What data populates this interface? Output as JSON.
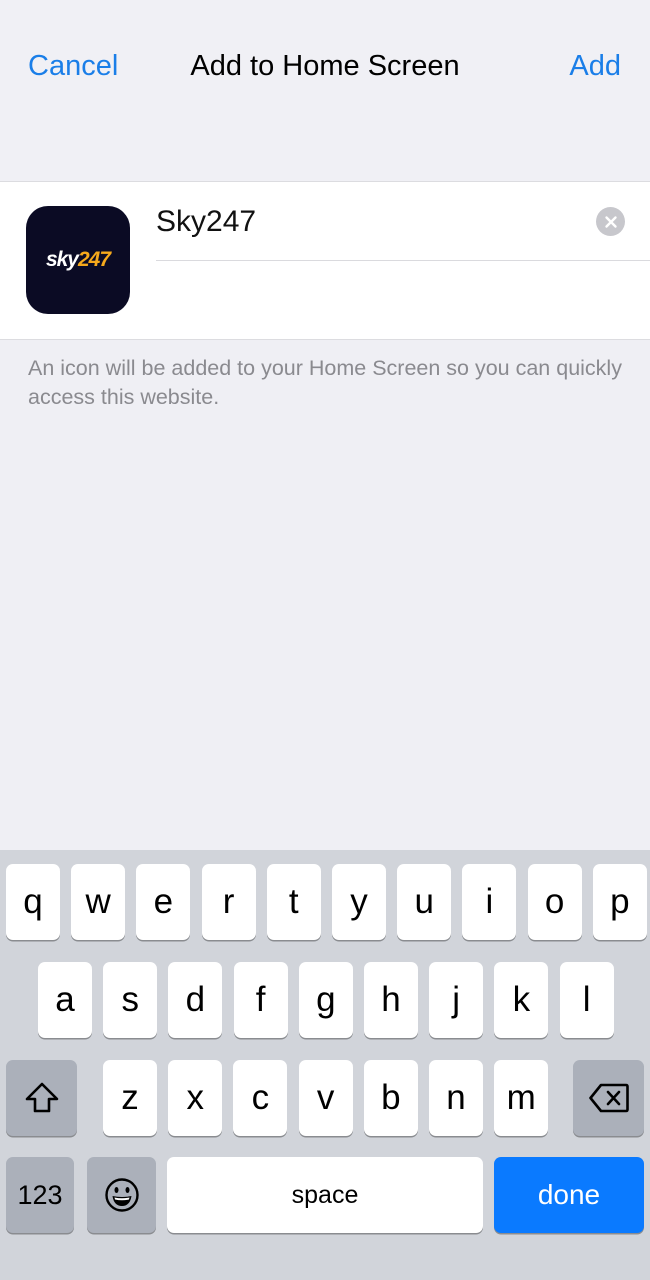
{
  "nav": {
    "cancel_label": "Cancel",
    "title": "Add to Home Screen",
    "add_label": "Add",
    "accent_color": "#1a7ee8"
  },
  "app": {
    "icon_text_primary": "sky",
    "icon_text_secondary": "247",
    "icon_bg_color": "#0b0b24",
    "icon_accent_color": "#f6a91c",
    "name_value": "Sky247",
    "clear_icon": "clear-circle-icon"
  },
  "footer_note": "An icon will be added to your Home Screen so you can quickly access this website.",
  "keyboard": {
    "row1": [
      "q",
      "w",
      "e",
      "r",
      "t",
      "y",
      "u",
      "i",
      "o",
      "p"
    ],
    "row2": [
      "a",
      "s",
      "d",
      "f",
      "g",
      "h",
      "j",
      "k",
      "l"
    ],
    "row3": [
      "z",
      "x",
      "c",
      "v",
      "b",
      "n",
      "m"
    ],
    "shift_icon": "shift-arrow-icon",
    "delete_icon": "backspace-icon",
    "numbers_label": "123",
    "emoji_icon": "emoji-smiley-icon",
    "space_label": "space",
    "done_label": "done",
    "done_color": "#0a7aff"
  }
}
